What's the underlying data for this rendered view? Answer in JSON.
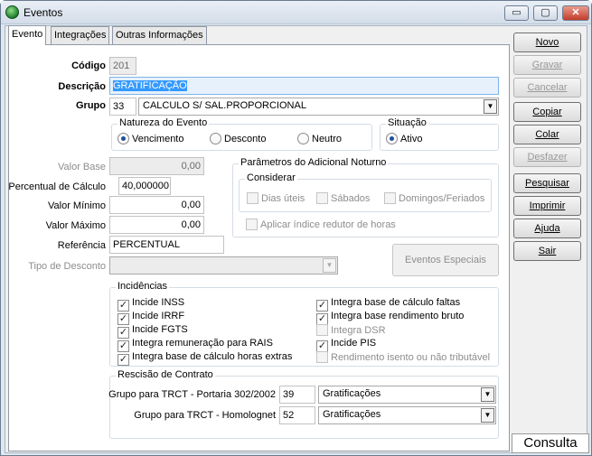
{
  "window": {
    "title": "Eventos",
    "minimize": "▭",
    "maximize": "▢",
    "close": "✕"
  },
  "tabs": [
    "Evento",
    "Integrações",
    "Outras Informações"
  ],
  "form": {
    "codigo_label": "Código",
    "codigo_value": "201",
    "descricao_label": "Descrição",
    "descricao_value": "GRATIFICAÇÃO",
    "grupo_label": "Grupo",
    "grupo_code": "33",
    "grupo_value": "CALCULO S/ SAL.PROPORCIONAL",
    "valor_base_label": "Valor Base",
    "valor_base_value": "0,00",
    "percentual_label": "Percentual de Cálculo",
    "percentual_value": "40,000000",
    "valor_minimo_label": "Valor Mínimo",
    "valor_minimo_value": "0,00",
    "valor_maximo_label": "Valor Máximo",
    "valor_maximo_value": "0,00",
    "referencia_label": "Referência",
    "referencia_value": "PERCENTUAL",
    "tipo_desconto_label": "Tipo de Desconto",
    "tipo_desconto_value": ""
  },
  "natureza": {
    "title": "Natureza do Evento",
    "options": [
      "Vencimento",
      "Desconto",
      "Neutro"
    ],
    "selected": "Vencimento"
  },
  "situacao": {
    "title": "Situação",
    "option": "Ativo"
  },
  "noturno": {
    "title": "Parâmetros do Adicional Noturno",
    "considerar_title": "Considerar",
    "options": [
      "Dias úteis",
      "Sábados",
      "Domingos/Feriados"
    ],
    "redutor": "Aplicar índice redutor de horas",
    "especiais_button": "Eventos Especiais"
  },
  "incidencias": {
    "title": "Incidências",
    "left": [
      {
        "label": "Incide INSS",
        "checked": true
      },
      {
        "label": "Incide IRRF",
        "checked": true
      },
      {
        "label": "Incide FGTS",
        "checked": true
      },
      {
        "label": "Integra remuneração para RAIS",
        "checked": true
      },
      {
        "label": "Integra base de cálculo horas extras",
        "checked": true
      }
    ],
    "right": [
      {
        "label": "Integra base de cálculo faltas",
        "checked": true
      },
      {
        "label": "Integra base rendimento bruto",
        "checked": true
      },
      {
        "label": "Integra DSR",
        "checked": false
      },
      {
        "label": "Incide PIS",
        "checked": true
      },
      {
        "label": "Rendimento isento ou não tributável",
        "checked": false
      }
    ]
  },
  "rescisao": {
    "title": "Rescisão de Contrato",
    "row1_label": "Grupo para TRCT - Portaria 302/2002",
    "row1_code": "39",
    "row1_value": "Gratificações",
    "row2_label": "Grupo para TRCT - Homolognet",
    "row2_code": "52",
    "row2_value": "Gratificações"
  },
  "buttons": {
    "novo": "Novo",
    "gravar": "Gravar",
    "cancelar": "Cancelar",
    "copiar": "Copiar",
    "colar": "Colar",
    "desfazer": "Desfazer",
    "pesquisar": "Pesquisar",
    "imprimir": "Imprimir",
    "ajuda": "Ajuda",
    "sair": "Sair"
  },
  "status": "Consulta",
  "icons": {
    "check": "✓",
    "dropdown": "▼"
  }
}
